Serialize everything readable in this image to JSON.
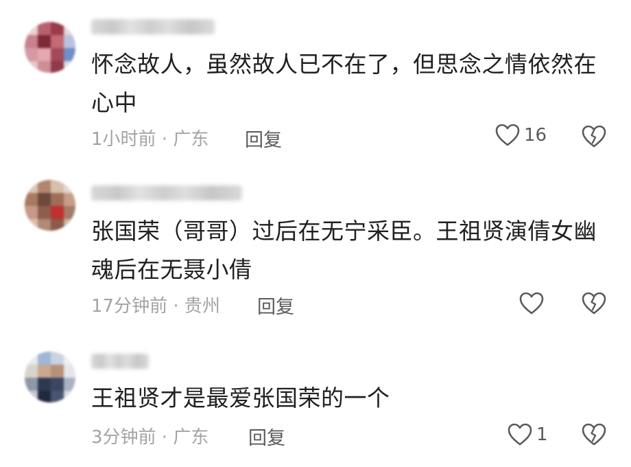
{
  "comments": [
    {
      "username": "████ ████ ██",
      "text": "怀念故人，虽然故人已不在了，但思念之情依然在心中",
      "line1": "怀念故人，虽然故人已不在了，但思念之情依然在",
      "line2": "心中",
      "meta": "1小时前 · 广东",
      "reply_label": "回复",
      "like_count": "16"
    },
    {
      "username": "█████ ████",
      "text": "张国荣（哥哥）过后在无宁采臣。王祖贤演倩女幽魂后在无聂小倩",
      "line1": "张国荣（哥哥）过后在无宁采臣。王祖贤演倩女幽",
      "line2": "魂后在无聂小倩",
      "meta": "17分钟前 · 贵州",
      "reply_label": "回复",
      "like_count": ""
    },
    {
      "username": "███",
      "text": "王祖贤才是最爱张国荣的一个",
      "line1": "王祖贤才是最爱张国荣的一个",
      "line2": "",
      "meta": "3分钟前 · 广东",
      "reply_label": "回复",
      "like_count": "1"
    }
  ],
  "icons": {
    "like": "heart-outline-icon",
    "dislike": "broken-heart-icon"
  },
  "colors": {
    "text": "#202020",
    "meta": "#a3a3a3",
    "action": "#5a5a5a"
  }
}
